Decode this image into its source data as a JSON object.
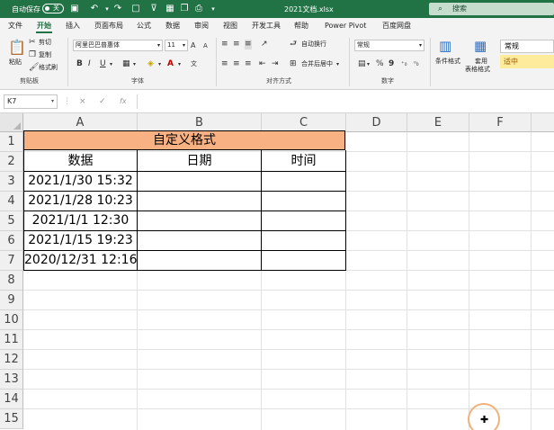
{
  "titlebar": {
    "autosave_label": "自动保存",
    "autosave_state": "关",
    "file_name": "2021文档.xlsx",
    "search_placeholder": "搜索"
  },
  "tabs": [
    "文件",
    "开始",
    "插入",
    "页面布局",
    "公式",
    "数据",
    "审阅",
    "视图",
    "开发工具",
    "帮助",
    "Power Pivot",
    "百度网盘"
  ],
  "active_tab": "开始",
  "ribbon": {
    "clipboard": {
      "paste": "粘贴",
      "cut": "剪切",
      "copy": "复制",
      "format_painter": "格式刷",
      "group": "剪贴板"
    },
    "font": {
      "font_name": "阿里巴巴普惠体",
      "font_size": "11",
      "bold": "B",
      "italic": "I",
      "underline": "U",
      "group": "字体",
      "fontcolor_letter": "A",
      "grow": "A",
      "shrink": "A"
    },
    "alignment": {
      "wrap": "自动换行",
      "merge": "合并后居中",
      "group": "对齐方式"
    },
    "number": {
      "format": "常规",
      "percent": "%",
      "comma": "9",
      "group": "数字"
    },
    "styles": {
      "conditional": "条件格式",
      "table_line1": "套用",
      "table_line2": "表格格式",
      "normal": "常规",
      "neutral": "适中"
    }
  },
  "formula_bar": {
    "name_box": "K7",
    "fx": "fx",
    "cancel": "×",
    "enter": "✓"
  },
  "columns": [
    "A",
    "B",
    "C",
    "D",
    "E",
    "F"
  ],
  "rows": [
    "1",
    "2",
    "3",
    "4",
    "5",
    "6",
    "7",
    "8",
    "9",
    "10",
    "11",
    "12",
    "13",
    "14",
    "15"
  ],
  "table": {
    "title": "自定义格式",
    "headers": [
      "数据",
      "日期",
      "时间"
    ],
    "data": [
      "2021/1/30 15:32",
      "2021/1/28 10:23",
      "2021/1/1 12:30",
      "2021/1/15 19:23",
      "2020/12/31 12:16"
    ]
  },
  "colors": {
    "excel_green": "#217346",
    "header_fill": "#f8b183",
    "neutral_fill": "#ffeb9c"
  }
}
